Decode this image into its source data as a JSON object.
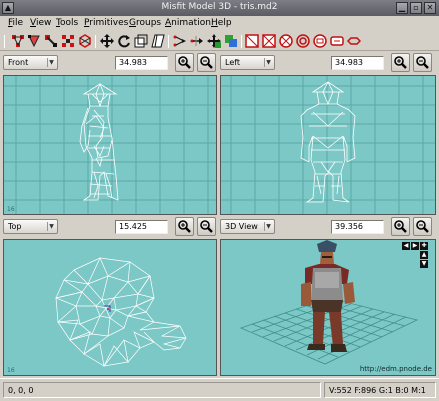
{
  "window": {
    "title": "Misfit Model 3D - tris.md2"
  },
  "menu": [
    "File",
    "View",
    "Tools",
    "Primitives",
    "Groups",
    "Animation",
    "Help"
  ],
  "icons": {
    "toolbar": [
      "select-vertices-icon",
      "select-faces-icon",
      "select-bones-icon",
      "select-point-icon",
      "select-projection-icon",
      "move-icon",
      "rotate-icon",
      "scale-icon",
      "shear-icon",
      "attract-icon",
      "extrude-icon",
      "add-bone-icon",
      "paint-icon",
      "cube-icon",
      "ellipsoid-icon",
      "cylinder-icon",
      "torus-icon",
      "polygon-icon",
      "rectangle-icon",
      "bone-icon"
    ]
  },
  "viewports": {
    "front": {
      "label": "Front",
      "zoom": "34.983",
      "corner": "16"
    },
    "left": {
      "label": "Left",
      "zoom": "34.983"
    },
    "top": {
      "label": "Top",
      "zoom": "15.425",
      "corner": "16"
    },
    "view3d": {
      "label": "3D View",
      "zoom": "39.356",
      "watermark": "http://edm.pnode.de"
    }
  },
  "status": {
    "coords": "0, 0, 0",
    "stats": "V:552  F:896  G:1  B:0  M:1"
  },
  "colors": {
    "viewport": "#7cc8c6",
    "grid": "#5aa9a6",
    "wire": "#ffffff"
  }
}
